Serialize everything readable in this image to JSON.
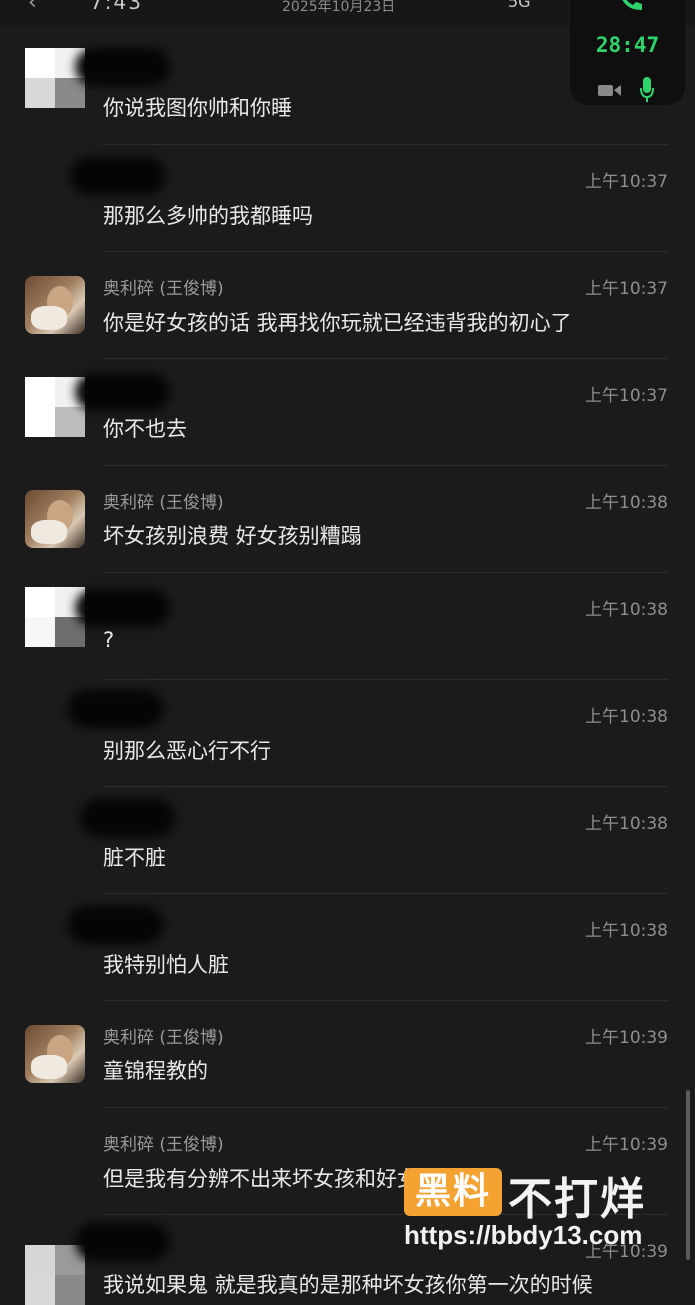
{
  "status_bar": {
    "date": "2025年10月23日",
    "back_glyph": "‹",
    "left_fragment": "7:43",
    "right_fragment": "5G"
  },
  "call": {
    "timer": "28:47",
    "accent": "#2fd36b"
  },
  "messages": [
    {
      "sender": "",
      "time": "",
      "text": "你说我图你帅和你睡",
      "avatar": "pixelated"
    },
    {
      "sender": "",
      "time": "上午10:37",
      "text": "那那么多帅的我都睡吗",
      "avatar": "none"
    },
    {
      "sender": "奥利碎 (王俊博)",
      "time": "上午10:37",
      "text": "你是好女孩的话 我再找你玩就已经违背我的初心了",
      "avatar": "photo"
    },
    {
      "sender": "",
      "time": "上午10:37",
      "text": "你不也去",
      "avatar": "pixelated"
    },
    {
      "sender": "奥利碎 (王俊博)",
      "time": "上午10:38",
      "text": "坏女孩别浪费 好女孩别糟蹋",
      "avatar": "photo"
    },
    {
      "sender": "",
      "time": "上午10:38",
      "text": "?",
      "avatar": "pixelated"
    },
    {
      "sender": "",
      "time": "上午10:38",
      "text": "别那么恶心行不行",
      "avatar": "none"
    },
    {
      "sender": "",
      "time": "上午10:38",
      "text": "脏不脏",
      "avatar": "none"
    },
    {
      "sender": "",
      "time": "上午10:38",
      "text": "我特别怕人脏",
      "avatar": "none"
    },
    {
      "sender": "奥利碎 (王俊博)",
      "time": "上午10:39",
      "text": "童锦程教的",
      "avatar": "photo"
    },
    {
      "sender": "奥利碎 (王俊博)",
      "time": "上午10:39",
      "text": "但是我有分辨不出来坏女孩和好女孩",
      "avatar": "none"
    },
    {
      "sender": "",
      "time": "上午10:39",
      "text": "我说如果鬼 就是我真的是那种坏女孩你第一次的时候",
      "avatar": "pixelated"
    }
  ],
  "watermark": {
    "badge": "黑料",
    "title": "不打烊",
    "url": "https://bbdy13.com",
    "badge_color": "#f4a232"
  }
}
